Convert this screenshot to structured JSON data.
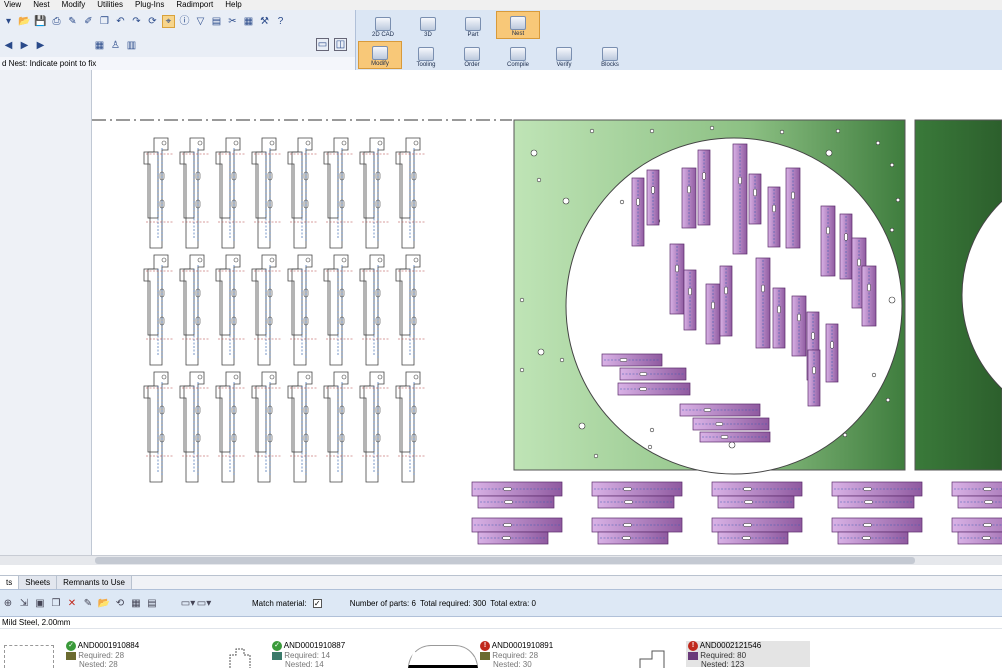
{
  "menu": [
    "View",
    "Nest",
    "Modify",
    "Utilities",
    "Plug-Ins",
    "Radimport",
    "Help"
  ],
  "toolbar": {
    "row1_icons": [
      "new-icon",
      "open-icon",
      "save-icon",
      "print-icon",
      "pencil-icon",
      "brush-icon",
      "copy-icon",
      "undo-icon",
      "redo-icon",
      "rotate-icon",
      "select-icon",
      "info-icon",
      "filter-icon",
      "chart-icon",
      "scissors-icon",
      "calculator-icon",
      "tools-icon",
      "help-icon"
    ],
    "row2_icons": [
      "prev-icon",
      "play-icon",
      "next-icon",
      "grid-icon",
      "person-icon",
      "table-icon"
    ]
  },
  "status": "d Nest: Indicate point to fix",
  "ribbon": {
    "top": [
      {
        "label": "2D CAD",
        "active": false
      },
      {
        "label": "3D",
        "active": false
      },
      {
        "label": "Part",
        "active": false
      },
      {
        "label": "Nest",
        "active": true
      }
    ],
    "bottom": [
      {
        "label": "Modify",
        "active": true
      },
      {
        "label": "Tooling",
        "active": false
      },
      {
        "label": "Order",
        "active": false
      },
      {
        "label": "Compile",
        "active": false
      },
      {
        "label": "Verify",
        "active": false
      },
      {
        "label": "Blocks",
        "active": false
      }
    ]
  },
  "tabs": [
    "ts",
    "Sheets",
    "Remnants to Use"
  ],
  "partbar": {
    "match_material_label": "Match material:",
    "match_material_checked": true,
    "number_of_parts": "Number of parts: 6",
    "total_required": "Total required: 300",
    "total_extra": "Total extra: 0"
  },
  "material": "Mild Steel, 2.00mm",
  "parts": [
    {
      "id": "AND0001910884",
      "status": "ok",
      "swatch": "#6b6b30",
      "required": "Required: 28",
      "nested": "Nested: 28"
    },
    {
      "id": "AND0001910887",
      "status": "ok",
      "swatch": "#3a7a6a",
      "required": "Required: 14",
      "nested": "Nested: 14"
    },
    {
      "id": "AND0001910891",
      "status": "error",
      "swatch": "#6b6b30",
      "required": "Required: 28",
      "nested": "Nested: 30"
    },
    {
      "id": "AND0002121546",
      "status": "error",
      "swatch": "#6a3a7a",
      "required": "Required: 80",
      "nested": "Nested: 123"
    }
  ],
  "colors": {
    "sheet_light": "#b8e0b0",
    "sheet_dark": "#2e6a32",
    "part_fill": "#c99ad8",
    "part_dark": "#7a4a8a",
    "accent": "#f8c878"
  }
}
